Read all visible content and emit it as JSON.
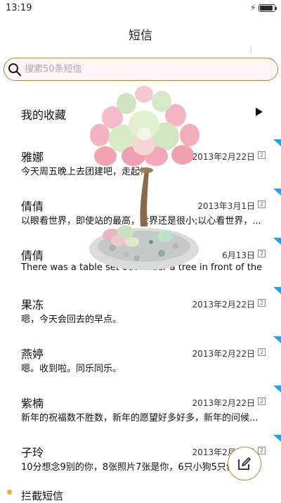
{
  "status": {
    "time": "13:19",
    "battery_level": 0.92
  },
  "header": {
    "title": "短信"
  },
  "search": {
    "placeholder": "搜索50条短信",
    "value": ""
  },
  "favorites": {
    "label": "我的收藏"
  },
  "conversations": [
    {
      "name": "雅娜",
      "date": "2013年2月22日",
      "count": "2",
      "preview": "今天周五晚上去团建吧，走起!"
    },
    {
      "name": "倩倩",
      "date": "2013年3月1日",
      "count": "2",
      "preview": "以眼看世界，即使站的最高，世界还是很小;以心看世界，..."
    },
    {
      "name": "倩倩",
      "date": "6月13日",
      "count": "2",
      "preview": "There was a table set out under a tree in front of the ho"
    },
    {
      "name": "果冻",
      "date": "2013年2月22日",
      "count": "2",
      "preview": "嗯，今天会回去的早点。"
    },
    {
      "name": "燕婷",
      "date": "2013年2月22日",
      "count": "2",
      "preview": "嗯。收到啦。同乐同乐。"
    },
    {
      "name": "紫楠",
      "date": "2013年2月22日",
      "count": "2",
      "preview": "新年的祝福数不胜数，新年的愿望好多好多，新年的问候..."
    },
    {
      "name": "子玲",
      "date": "2013年2月22日",
      "count": "2",
      "preview": "10分想念9别的你，8张照片7张是你，6只小狗5只像你"
    }
  ],
  "section": {
    "label": "拦截短信"
  },
  "colors": {
    "accent": "#2aa0e6",
    "outline": "#a48a3f",
    "section_dot": "#f2a93b"
  },
  "icons": {
    "search": "search-icon",
    "compose": "compose-icon",
    "arrow": "play-arrow-icon"
  }
}
